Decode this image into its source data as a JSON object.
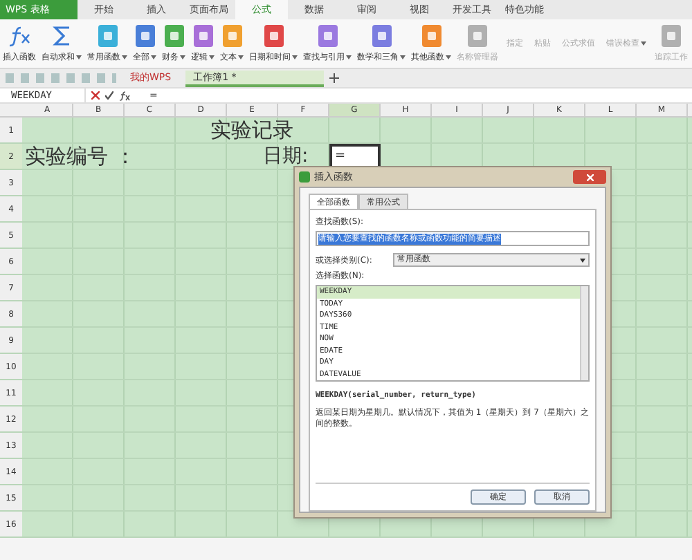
{
  "menu_tabs": [
    {
      "label": "WPS 表格",
      "kind": "app"
    },
    {
      "label": "开始",
      "selected": false
    },
    {
      "label": "插入",
      "selected": false
    },
    {
      "label": "页面布局",
      "selected": false
    },
    {
      "label": "公式",
      "selected": true
    },
    {
      "label": "数据",
      "selected": false
    },
    {
      "label": "审阅",
      "selected": false
    },
    {
      "label": "视图",
      "selected": false
    },
    {
      "label": "开发工具",
      "selected": false
    },
    {
      "label": "特色功能",
      "selected": false
    }
  ],
  "ribbon": [
    {
      "label": "插入函数",
      "kind": "fx",
      "color": "#3a7bd5",
      "dropdown": false,
      "disabled": false
    },
    {
      "label": "自动求和",
      "kind": "sigma",
      "color": "#3a7bd5",
      "dropdown": true,
      "disabled": false
    },
    {
      "label": "常用函数",
      "kind": "big",
      "color": "#3bb0d9",
      "dropdown": true,
      "disabled": false
    },
    {
      "label": "全部",
      "kind": "big",
      "color": "#4a7fd8",
      "dropdown": true,
      "disabled": false
    },
    {
      "label": "财务",
      "kind": "big",
      "color": "#4caf50",
      "dropdown": true,
      "disabled": false
    },
    {
      "label": "逻辑",
      "kind": "big",
      "color": "#a86fd8",
      "dropdown": true,
      "disabled": false
    },
    {
      "label": "文本",
      "kind": "big",
      "color": "#f0a030",
      "dropdown": true,
      "disabled": false
    },
    {
      "label": "日期和时间",
      "kind": "big",
      "color": "#e04848",
      "dropdown": true,
      "disabled": false
    },
    {
      "label": "查找与引用",
      "kind": "big",
      "color": "#9b79e0",
      "dropdown": true,
      "disabled": false
    },
    {
      "label": "数学和三角",
      "kind": "big",
      "color": "#7b7de0",
      "dropdown": true,
      "disabled": false
    },
    {
      "label": "其他函数",
      "kind": "big",
      "color": "#f08a30",
      "dropdown": true,
      "disabled": false
    },
    {
      "label": "名称管理器",
      "kind": "big",
      "color": "#b0b0b0",
      "dropdown": false,
      "disabled": true
    },
    {
      "label": "指定",
      "kind": "small",
      "dropdown": false,
      "disabled": true
    },
    {
      "label": "粘贴",
      "kind": "small",
      "dropdown": false,
      "disabled": true
    },
    {
      "label": "公式求值",
      "kind": "small",
      "dropdown": false,
      "disabled": true
    },
    {
      "label": "错误检查",
      "kind": "small",
      "dropdown": true,
      "disabled": true
    },
    {
      "label": "追踪工作",
      "kind": "big",
      "color": "#b0b0b0",
      "dropdown": false,
      "disabled": true
    }
  ],
  "doc_tabs": [
    {
      "label": "我的WPS",
      "selected": false
    },
    {
      "label": "工作簿1 *",
      "selected": true
    }
  ],
  "formula_bar": {
    "name_box": "WEEKDAY",
    "formula": "="
  },
  "sheet": {
    "columns": [
      {
        "label": "A",
        "selected": false
      },
      {
        "label": "B",
        "selected": false
      },
      {
        "label": "C",
        "selected": false
      },
      {
        "label": "D",
        "selected": false
      },
      {
        "label": "E",
        "selected": false
      },
      {
        "label": "F",
        "selected": false
      },
      {
        "label": "G",
        "selected": true
      },
      {
        "label": "H",
        "selected": false
      },
      {
        "label": "I",
        "selected": false
      },
      {
        "label": "J",
        "selected": false
      },
      {
        "label": "K",
        "selected": false
      },
      {
        "label": "L",
        "selected": false
      },
      {
        "label": "M",
        "selected": false
      }
    ],
    "rows": [
      {
        "label": "1",
        "selected": false
      },
      {
        "label": "2",
        "selected": true
      },
      {
        "label": "3",
        "selected": false
      },
      {
        "label": "4",
        "selected": false
      },
      {
        "label": "5",
        "selected": false
      },
      {
        "label": "6",
        "selected": false
      },
      {
        "label": "7",
        "selected": false
      },
      {
        "label": "8",
        "selected": false
      },
      {
        "label": "9",
        "selected": false
      },
      {
        "label": "10",
        "selected": false
      },
      {
        "label": "11",
        "selected": false
      },
      {
        "label": "12",
        "selected": false
      },
      {
        "label": "13",
        "selected": false
      },
      {
        "label": "14",
        "selected": false
      },
      {
        "label": "15",
        "selected": false
      },
      {
        "label": "16",
        "selected": false
      }
    ],
    "title": "实验记录",
    "number_label": "实验编号 ：",
    "date_label": "日期:",
    "active_cell": "="
  },
  "dialog": {
    "title": "插入函数",
    "tabs": [
      {
        "label": "全部函数",
        "selected": true
      },
      {
        "label": "常用公式",
        "selected": false
      }
    ],
    "search_label": "查找函数(S):",
    "search_value": "请输入您要查找的函数名称或函数功能的简要描述",
    "category_label": "或选择类别(C):",
    "category_value": "常用函数",
    "list_label": "选择函数(N):",
    "functions": [
      {
        "name": "WEEKDAY",
        "selected": true
      },
      {
        "name": "TODAY",
        "selected": false
      },
      {
        "name": "DAYS360",
        "selected": false
      },
      {
        "name": "TIME",
        "selected": false
      },
      {
        "name": "NOW",
        "selected": false
      },
      {
        "name": "EDATE",
        "selected": false
      },
      {
        "name": "DAY",
        "selected": false
      },
      {
        "name": "DATEVALUE",
        "selected": false
      }
    ],
    "signature": "WEEKDAY(serial_number, return_type)",
    "description": "返回某日期为星期几。默认情况下，其值为 1（星期天）到 7（星期六）之间的整数。",
    "buttons": [
      "确定",
      "取消"
    ]
  }
}
